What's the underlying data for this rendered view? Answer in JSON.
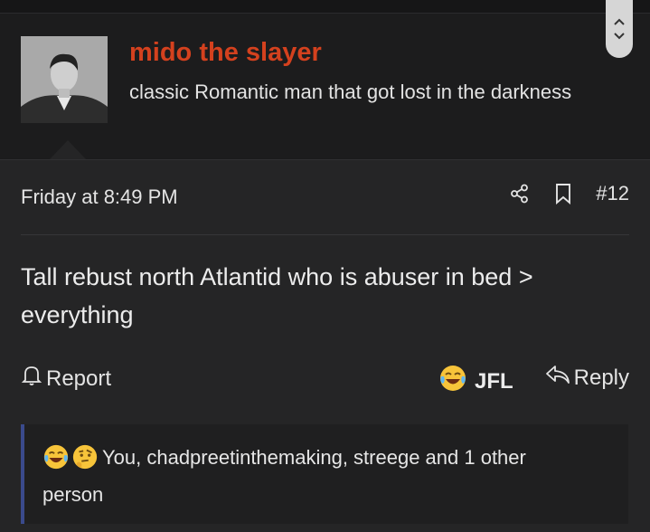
{
  "user": {
    "name": "mido the slayer",
    "title": "classic Romantic man that got lost in the darkness"
  },
  "post": {
    "date": "Friday at 8:49 PM",
    "number": "#12",
    "body": "Tall rebust north Atlantid who is abuser in bed > everything"
  },
  "actions": {
    "report_label": "Report",
    "reaction_label": "JFL",
    "reply_label": "Reply"
  },
  "reactions": {
    "summary": "You, chadpreetinthemaking, streege and 1 other person"
  },
  "icons": {
    "scroll_up": "chevron-up-icon",
    "scroll_down": "chevron-down-icon",
    "share": "share-icon",
    "bookmark": "bookmark-icon",
    "report": "bell-icon",
    "jfl": "tears-of-joy-emoji",
    "reply": "reply-arrow-icon",
    "reaction_1": "tears-of-joy-emoji",
    "reaction_2": "thinking-face-emoji"
  },
  "colors": {
    "username": "#d4411e",
    "background": "#252526",
    "reaction_bar": "#3a4a8c"
  }
}
